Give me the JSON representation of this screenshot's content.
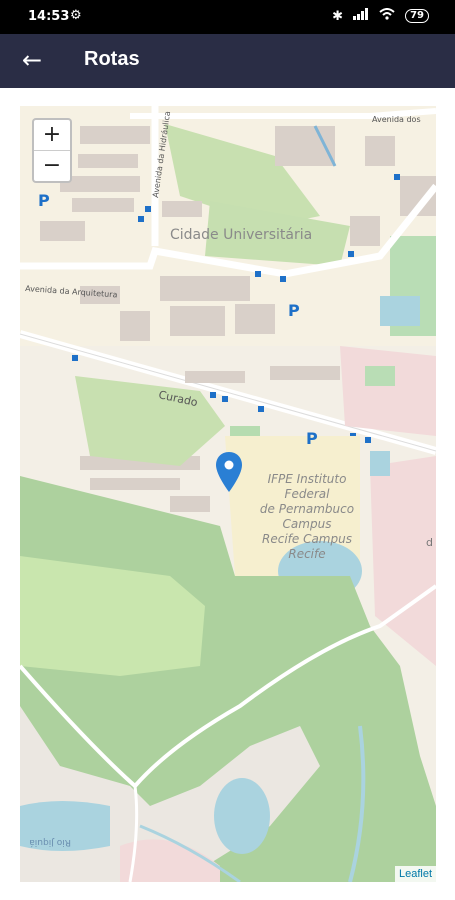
{
  "status": {
    "time": "14:53",
    "battery": "79"
  },
  "appbar": {
    "title": "Rotas"
  },
  "map": {
    "zoom_in": "+",
    "zoom_out": "−",
    "attribution": "Leaflet",
    "labels": {
      "area": "Cidade Universitária",
      "avenue_arquitetura": "Avenida da Arquitetura",
      "avenue_top": "Avenida dos",
      "avenue_vertical": "Avenida da Hidráulica",
      "curado": "Curado",
      "ifpe": [
        "IFPE Instituto",
        "Federal",
        "de Pernambuco",
        "Campus",
        "Recife Campus",
        "Recife"
      ],
      "river": "Rio Jiquiá",
      "right_d": "d"
    }
  },
  "colors": {
    "appbar": "#2a2d45",
    "park": "#add19e",
    "water": "#aad3df",
    "residential": "#f2dada",
    "marker": "#2a7fd4"
  }
}
